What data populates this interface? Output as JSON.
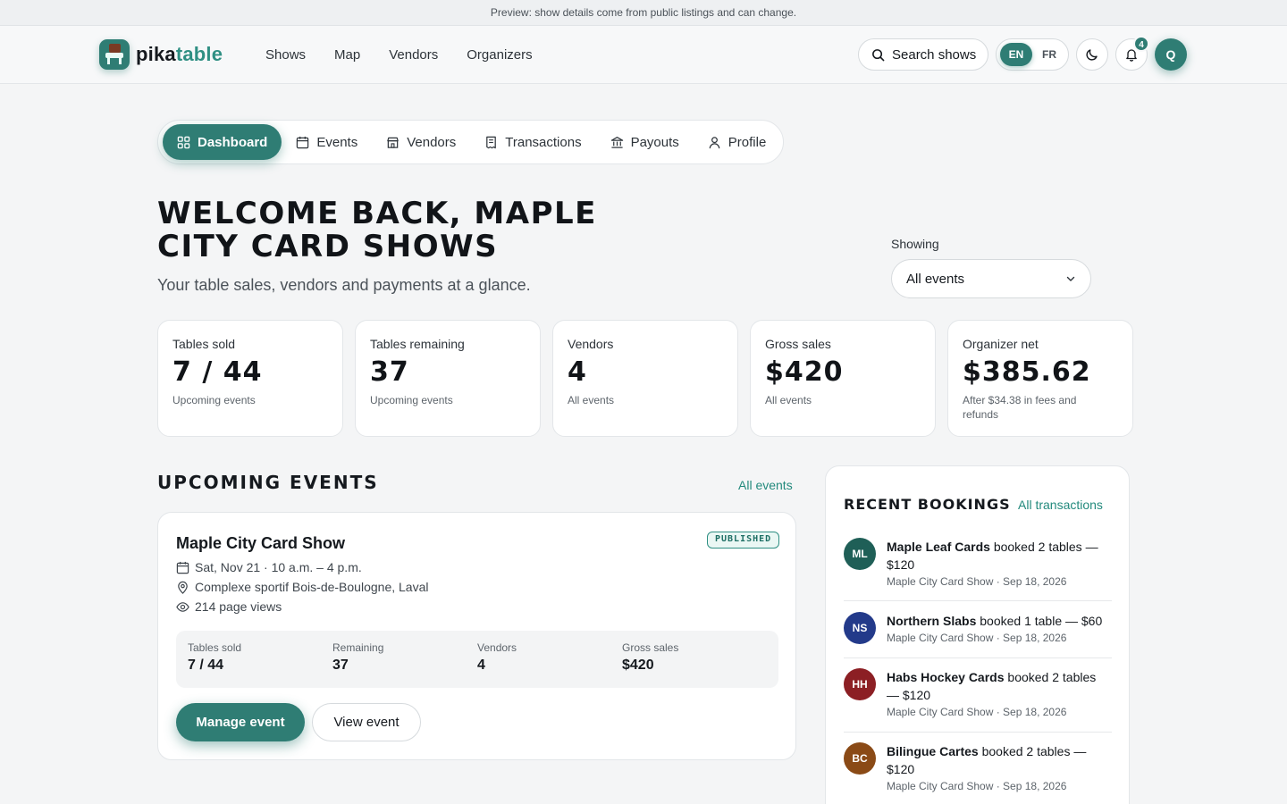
{
  "preview_banner": "Preview: show details come from public listings and can change.",
  "brand": {
    "name_a": "pika",
    "name_b": "table"
  },
  "topnav": {
    "links": [
      "Shows",
      "Map",
      "Vendors",
      "Organizers"
    ],
    "search_label": "Search shows",
    "lang_en": "EN",
    "lang_fr": "FR",
    "notification_count": "4",
    "avatar_initial": "Q"
  },
  "subnav": [
    "Dashboard",
    "Events",
    "Vendors",
    "Transactions",
    "Payouts",
    "Profile"
  ],
  "welcome": {
    "title": "Welcome back, Maple City Card Shows",
    "tagline": "Your table sales, vendors and payments at a glance.",
    "showing_label": "Showing",
    "showing_value": "All events"
  },
  "stats": [
    {
      "label": "Tables sold",
      "value": "7 / 44",
      "sub": "Upcoming events"
    },
    {
      "label": "Tables remaining",
      "value": "37",
      "sub": "Upcoming events"
    },
    {
      "label": "Vendors",
      "value": "4",
      "sub": "All events"
    },
    {
      "label": "Gross sales",
      "value": "$420",
      "sub": "All events"
    },
    {
      "label": "Organizer net",
      "value": "$385.62",
      "sub": "After $34.38 in fees and refunds"
    }
  ],
  "upcoming": {
    "title": "Upcoming events",
    "link": "All events",
    "event": {
      "name": "Maple City Card Show",
      "status": "PUBLISHED",
      "date": "Sat, Nov 21 · 10 a.m. – 4 p.m.",
      "venue": "Complexe sportif Bois-de-Boulogne, Laval",
      "views": "214 page views",
      "metrics": [
        {
          "label": "Tables sold",
          "value": "7 / 44"
        },
        {
          "label": "Remaining",
          "value": "37"
        },
        {
          "label": "Vendors",
          "value": "4"
        },
        {
          "label": "Gross sales",
          "value": "$420"
        }
      ],
      "manage_label": "Manage event",
      "view_label": "View event"
    }
  },
  "bookings": {
    "title": "Recent bookings",
    "link": "All transactions",
    "items": [
      {
        "initials": "ML",
        "color": "#1f5f57",
        "name": "Maple Leaf Cards",
        "action": " booked 2 tables — $120",
        "sub": "Maple City Card Show · Sep 18, 2026"
      },
      {
        "initials": "NS",
        "color": "#233a8a",
        "name": "Northern Slabs",
        "action": " booked 1 table — $60",
        "sub": "Maple City Card Show · Sep 18, 2026"
      },
      {
        "initials": "HH",
        "color": "#8c1f24",
        "name": "Habs Hockey Cards",
        "action": " booked 2 tables — $120",
        "sub": "Maple City Card Show · Sep 18, 2026"
      },
      {
        "initials": "BC",
        "color": "#8a4a16",
        "name": "Bilingue Cartes",
        "action": " booked 2 tables — $120",
        "sub": "Maple City Card Show · Sep 18, 2026"
      }
    ]
  }
}
